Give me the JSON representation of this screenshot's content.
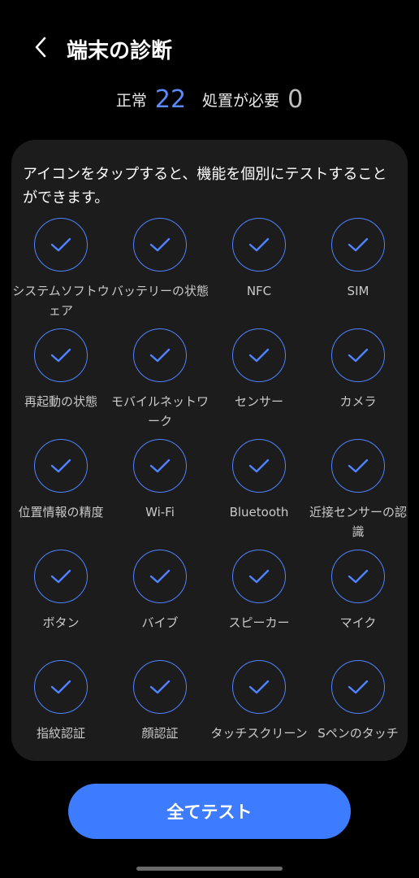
{
  "header": {
    "title": "端末の診断"
  },
  "summary": {
    "normal_label": "正常",
    "normal_count": "22",
    "needs_action_label": "処置が必要",
    "needs_action_count": "0"
  },
  "instructions": "アイコンをタップすると、機能を個別にテストすることができます。",
  "items": [
    {
      "label": "システムソフトウェア"
    },
    {
      "label": "バッテリーの状態"
    },
    {
      "label": "NFC"
    },
    {
      "label": "SIM"
    },
    {
      "label": "再起動の状態"
    },
    {
      "label": "モバイルネットワーク"
    },
    {
      "label": "センサー"
    },
    {
      "label": "カメラ"
    },
    {
      "label": "位置情報の精度"
    },
    {
      "label": "Wi-Fi"
    },
    {
      "label": "Bluetooth"
    },
    {
      "label": "近接センサーの認識"
    },
    {
      "label": "ボタン"
    },
    {
      "label": "バイブ"
    },
    {
      "label": "スピーカー"
    },
    {
      "label": "マイク"
    },
    {
      "label": "指紋認証"
    },
    {
      "label": "顔認証"
    },
    {
      "label": "タッチスクリーン"
    },
    {
      "label": "Sペンのタッチ"
    }
  ],
  "button": {
    "test_all_label": "全てテスト"
  },
  "colors": {
    "accent": "#3d7bff",
    "check": "#4f83ff",
    "card_bg": "#1c1c1c"
  }
}
